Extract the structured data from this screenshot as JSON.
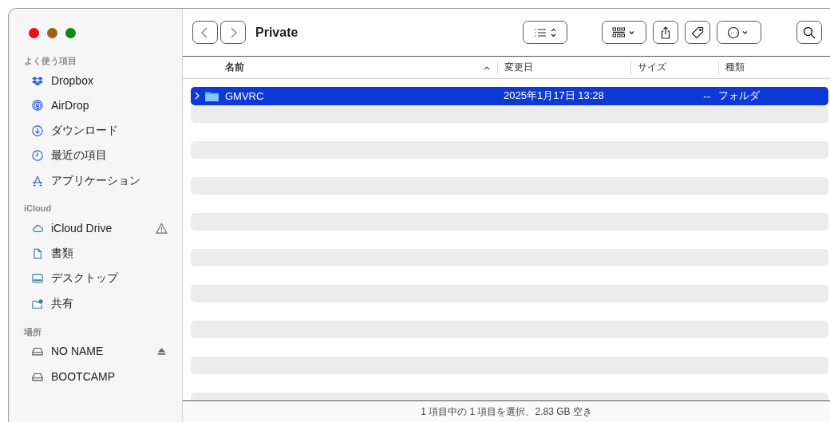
{
  "window": {
    "title": "Private"
  },
  "sidebar": {
    "sections": [
      {
        "heading": "よく使う項目",
        "items": [
          {
            "label": "Dropbox",
            "kind": "dropbox"
          },
          {
            "label": "AirDrop",
            "kind": "airdrop"
          },
          {
            "label": "ダウンロード",
            "kind": "download"
          },
          {
            "label": "最近の項目",
            "kind": "recent"
          },
          {
            "label": "アプリケーション",
            "kind": "apps"
          }
        ]
      },
      {
        "heading": "iCloud",
        "items": [
          {
            "label": "iCloud Drive",
            "kind": "cloud",
            "warning": true
          },
          {
            "label": "書類",
            "kind": "documents",
            "warning": false
          },
          {
            "label": "デスクトップ",
            "kind": "desktop",
            "warning": false
          },
          {
            "label": "共有",
            "kind": "shared",
            "warning": false
          }
        ]
      },
      {
        "heading": "場所",
        "items": [
          {
            "label": "NO NAME",
            "kind": "drive",
            "ejectable": true
          },
          {
            "label": "BOOTCAMP",
            "kind": "drive",
            "ejectable": false
          }
        ]
      }
    ]
  },
  "table": {
    "columns": [
      {
        "label": "名前",
        "sorted": true
      },
      {
        "label": "変更日",
        "sorted": false
      },
      {
        "label": "サイズ",
        "sorted": false
      },
      {
        "label": "種類",
        "sorted": false
      }
    ],
    "rows": [
      {
        "name": "GMVRC",
        "modified": "2025年1月17日 13:28",
        "size": "--",
        "kind": "フォルダ",
        "selected": true
      }
    ]
  },
  "status_bar": "1 項目中の 1 項目を選択、2.83 GB 空き"
}
